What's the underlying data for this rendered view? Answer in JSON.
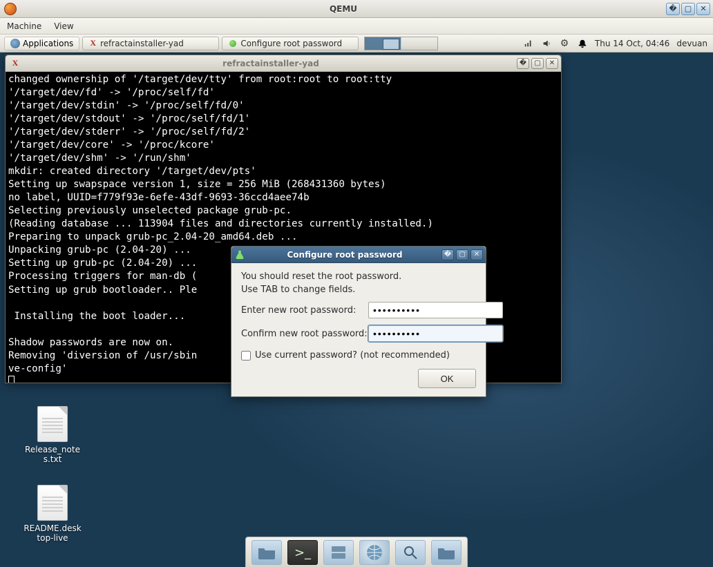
{
  "outer_window": {
    "title": "QEMU",
    "menu": {
      "machine": "Machine",
      "view": "View"
    }
  },
  "panel": {
    "applications_label": "Applications",
    "task_installer": "refractainstaller-yad",
    "task_configure": "Configure root password",
    "clock": "Thu 14 Oct, 04:46",
    "user": "devuan"
  },
  "terminal": {
    "title": "refractainstaller-yad",
    "lines": "changed ownership of '/target/dev/tty' from root:root to root:tty\n'/target/dev/fd' -> '/proc/self/fd'\n'/target/dev/stdin' -> '/proc/self/fd/0'\n'/target/dev/stdout' -> '/proc/self/fd/1'\n'/target/dev/stderr' -> '/proc/self/fd/2'\n'/target/dev/core' -> '/proc/kcore'\n'/target/dev/shm' -> '/run/shm'\nmkdir: created directory '/target/dev/pts'\nSetting up swapspace version 1, size = 256 MiB (268431360 bytes)\nno label, UUID=f779f93e-6efe-43df-9693-36ccd4aee74b\nSelecting previously unselected package grub-pc.\n(Reading database ... 113904 files and directories currently installed.)\nPreparing to unpack grub-pc_2.04-20_amd64.deb ...\nUnpacking grub-pc (2.04-20) ...\nSetting up grub-pc (2.04-20) ...\nProcessing triggers for man-db (\nSetting up grub bootloader.. Ple\n\n Installing the boot loader...\n\nShadow passwords are now on.\nRemoving 'diversion of /usr/sbin                                      cron by li\nve-config'"
  },
  "dialog": {
    "title": "Configure root password",
    "hint_line1": "You should reset the root password.",
    "hint_line2": "Use TAB to change fields.",
    "label_new": "Enter new root password:",
    "label_confirm": "Confirm new root password:",
    "value_new": "●●●●●●●●●●",
    "value_confirm": "●●●●●●●●●●",
    "checkbox_label": "Use current password? (not recommended)",
    "ok_label": "OK"
  },
  "desktop": {
    "icon1": "Release_note\ns.txt",
    "icon2": "README.desk\ntop-live"
  }
}
